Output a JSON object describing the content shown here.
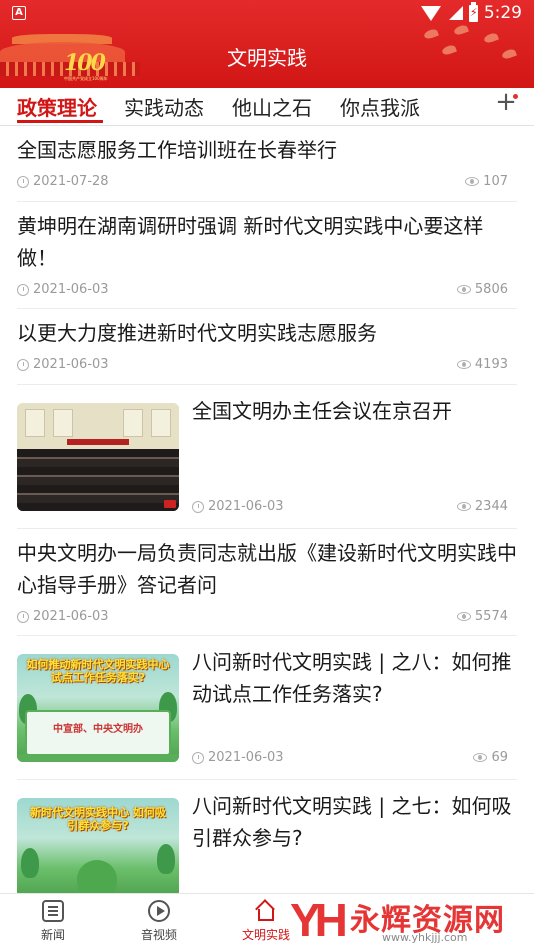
{
  "status_bar": {
    "left_icon_letter": "A",
    "time": "5:29",
    "battery_symbol": "⚡"
  },
  "header": {
    "title": "文明实践",
    "logo_number": "100",
    "logo_caption": "中国共产党成立100周年",
    "brand_color": "#d21616"
  },
  "tabs": [
    {
      "label": "政策理论",
      "active": true
    },
    {
      "label": "实践动态",
      "active": false
    },
    {
      "label": "他山之石",
      "active": false
    },
    {
      "label": "你点我派",
      "active": false
    }
  ],
  "tab_more_label": "+",
  "articles": [
    {
      "title": "全国志愿服务工作培训班在长春举行",
      "date": "2021-07-28",
      "views": "107"
    },
    {
      "title": "黄坤明在湖南调研时强调 新时代文明实践中心要这样做！",
      "date": "2021-06-03",
      "views": "5806"
    },
    {
      "title": "以更大力度推进新时代文明实践志愿服务",
      "date": "2021-06-03",
      "views": "4193"
    },
    {
      "title": "全国文明办主任会议在京召开",
      "date": "2021-06-03",
      "views": "2344",
      "thumbnail": "meeting-photo"
    },
    {
      "title": "中央文明办一局负责同志就出版《建设新时代文明实践中心指导手册》答记者问",
      "date": "2021-06-03",
      "views": "5574"
    },
    {
      "title": "八问新时代文明实践 | 之八：如何推动试点工作任务落实?",
      "date": "2021-06-03",
      "views": "69",
      "thumbnail": "poster-green",
      "thumb_title": "如何推动新时代文明实践中心试点工作任务落实?",
      "thumb_caption": "中宣部、中央文明办"
    },
    {
      "title": "八问新时代文明实践 | 之七：如何吸引群众参与?",
      "thumbnail": "poster-green",
      "thumb_title": "新时代文明实践中心 如何吸引群众参与?"
    }
  ],
  "bottom_nav": [
    {
      "label": "新闻",
      "icon": "news-icon",
      "active": false
    },
    {
      "label": "音视频",
      "icon": "video-icon",
      "active": false
    },
    {
      "label": "文明实践",
      "icon": "home-icon",
      "active": true
    }
  ],
  "watermark": {
    "logo_text": "YH",
    "name": "永辉资源网",
    "url": "www.yhkjjj.com"
  }
}
